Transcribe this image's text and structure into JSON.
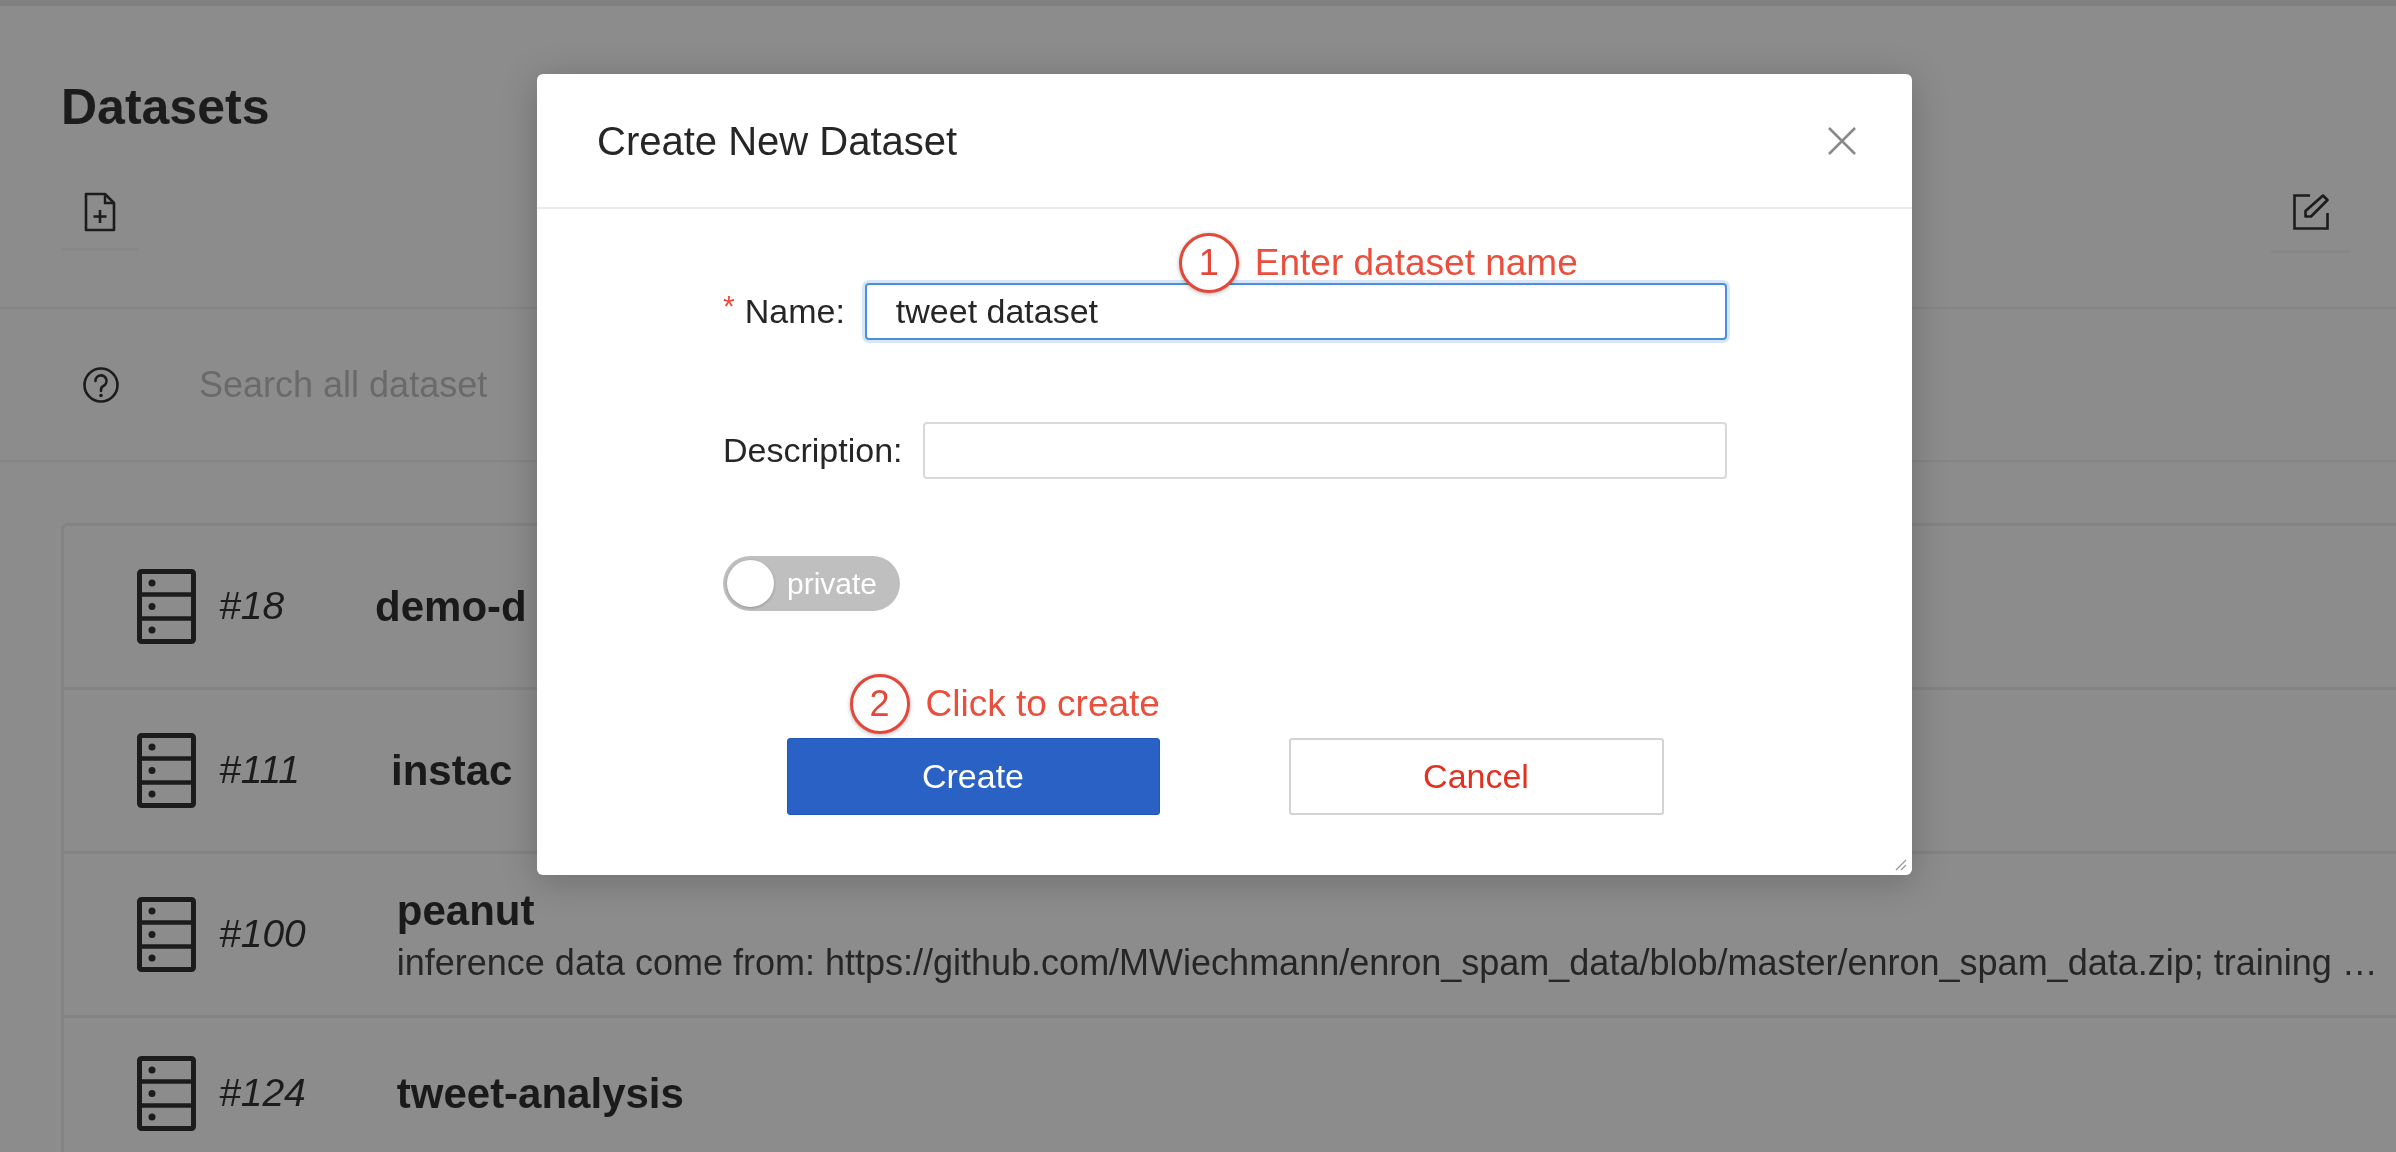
{
  "page": {
    "title": "Datasets"
  },
  "search": {
    "placeholder": "Search all dataset"
  },
  "datasets": [
    {
      "number": "#18",
      "name": "demo-d"
    },
    {
      "number": "#111",
      "name": "instac"
    },
    {
      "number": "#100",
      "name": "peanut",
      "description": "inference data come from: https://github.com/MWiechmann/enron_spam_data/blob/master/enron_spam_data.zip; training …"
    },
    {
      "number": "#124",
      "name": "tweet-analysis"
    }
  ],
  "dialog": {
    "title": "Create New Dataset",
    "fields": [
      {
        "required_mark": "*",
        "label": "Name:",
        "value": "tweet dataset",
        "focused": true,
        "annotation": {
          "number": "1",
          "text": "Enter dataset name"
        }
      },
      {
        "label": "Description:",
        "focused": false
      }
    ],
    "toggle": {
      "label": "private",
      "on": false
    },
    "buttons": [
      {
        "kind": "primary",
        "label": "Create",
        "annotation": {
          "number": "2",
          "text": "Click to create"
        }
      },
      {
        "kind": "secondary",
        "label": "Cancel"
      }
    ]
  }
}
